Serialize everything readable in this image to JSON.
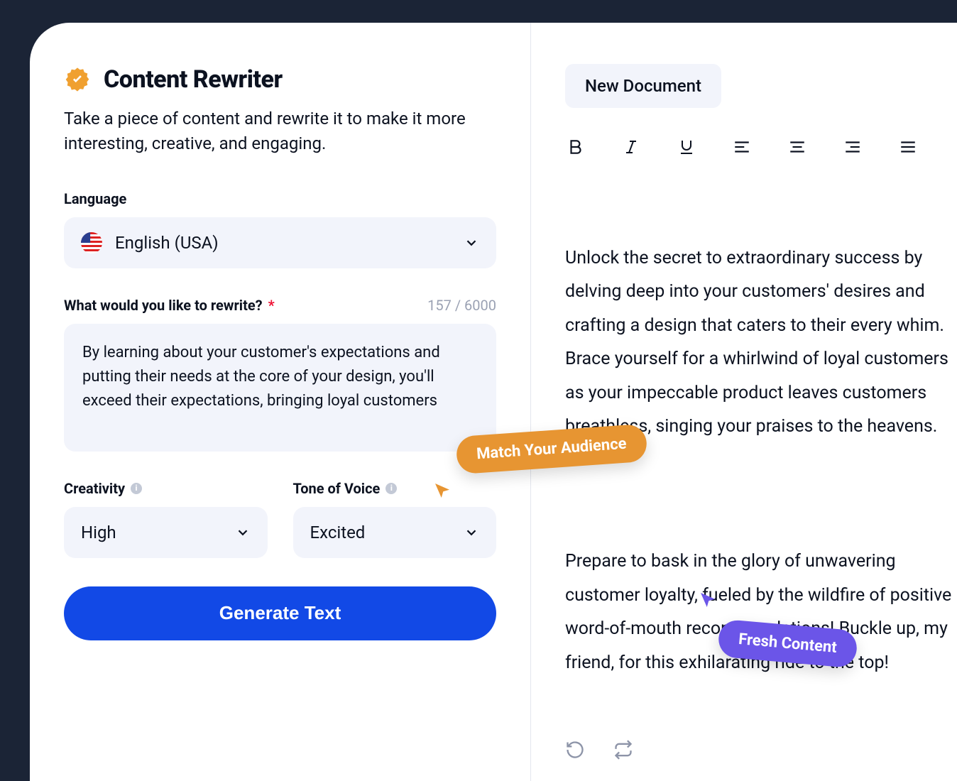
{
  "left": {
    "title": "Content Rewriter",
    "subtitle": "Take a piece of content and rewrite it to make it more interesting, creative, and engaging.",
    "language_label": "Language",
    "language_value": "English (USA)",
    "rewrite_label": "What would you like to rewrite?",
    "char_counter": "157 / 6000",
    "rewrite_value": "By learning about your customer's expectations and putting their needs at the core of your design, you'll exceed their expectations, bringing loyal customers",
    "creativity_label": "Creativity",
    "creativity_value": "High",
    "tone_label": "Tone of Voice",
    "tone_value": "Excited",
    "generate_btn": "Generate Text"
  },
  "right": {
    "doc_tab": "New Document",
    "paragraph1": "Unlock the secret to extraordinary success by delving deep into your customers' desires and crafting a design that caters to their every whim. Brace yourself for a whirlwind of loyal customers as your impeccable product leaves customers breathless, singing your praises to the heavens.",
    "paragraph2": "Prepare to bask in the glory of unwavering customer loyalty, fueled by the wildfire of positive word-of-mouth recommendations! Buckle up, my friend, for this exhilarating ride to the top!"
  },
  "callouts": {
    "orange": "Match Your Audience",
    "purple": "Fresh Content"
  }
}
